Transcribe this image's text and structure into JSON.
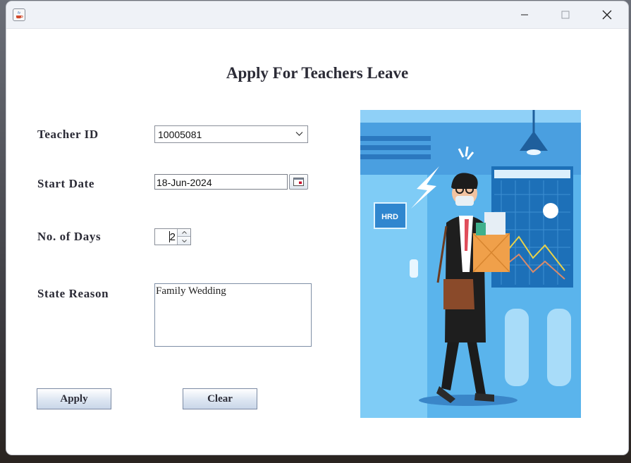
{
  "window": {
    "controls": {
      "minimize_icon": "minimize-icon",
      "maximize_icon": "maximize-icon",
      "close_icon": "close-icon"
    }
  },
  "form": {
    "title": "Apply For Teachers Leave",
    "teacher_id": {
      "label": "Teacher ID",
      "value": "10005081"
    },
    "start_date": {
      "label": "Start Date",
      "value": "18-Jun-2024"
    },
    "days": {
      "label": "No. of Days",
      "value": "2"
    },
    "reason": {
      "label": "State Reason",
      "value": "Family Wedding"
    },
    "apply_label": "Apply",
    "clear_label": "Clear"
  },
  "illustration": {
    "sign_text": "HRD"
  },
  "colors": {
    "button_gradient_top": "#ffffff",
    "button_gradient_bottom": "#c9d6e8",
    "illustration_bg": "#4a9fe0"
  }
}
